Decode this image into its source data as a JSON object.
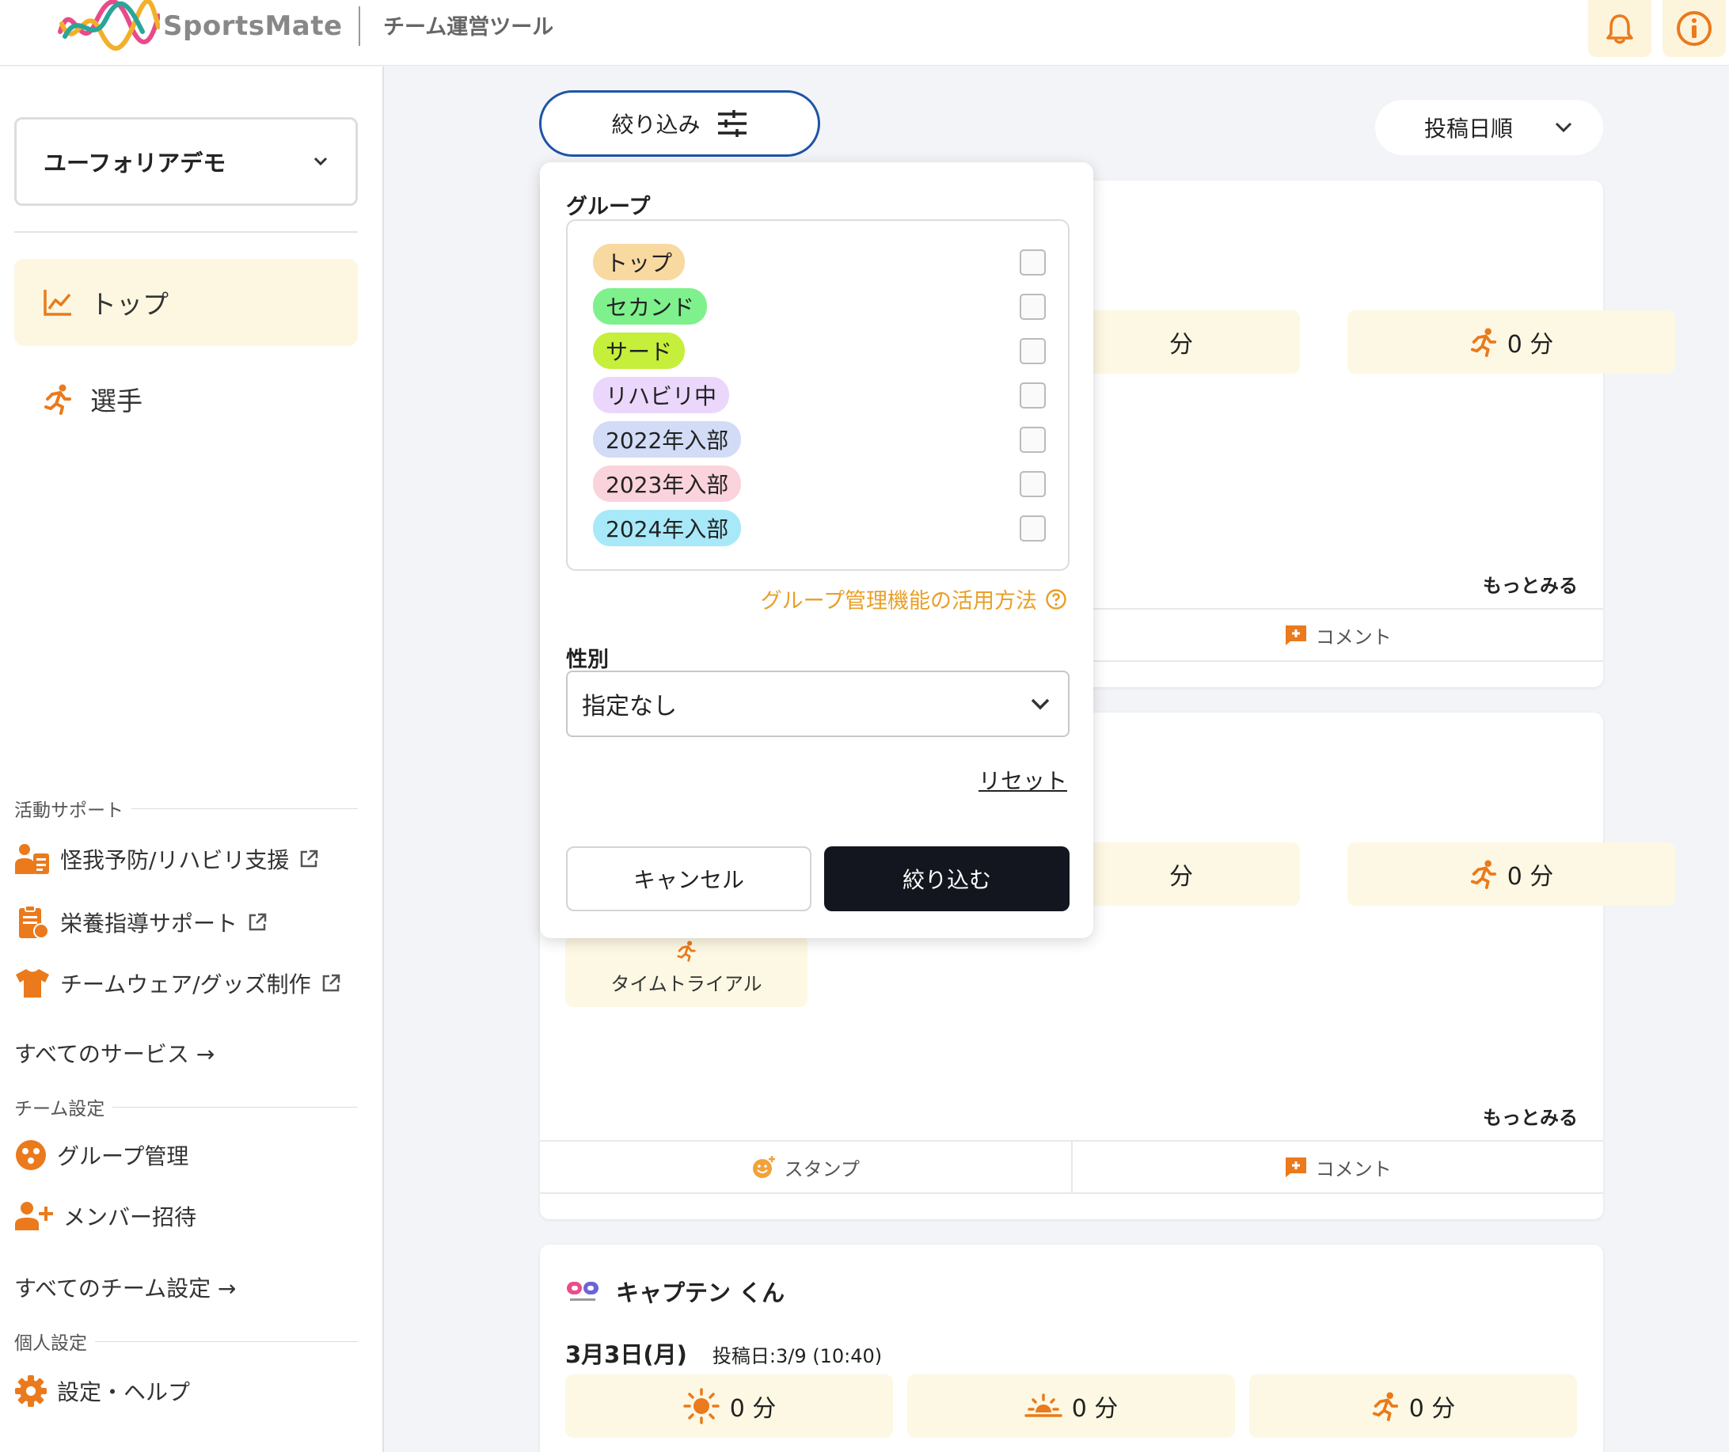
{
  "header": {
    "logo_text": "SportsMate",
    "subtitle": "チーム運営ツール",
    "bell_icon": "bell-icon",
    "info_icon": "info-icon"
  },
  "sidebar": {
    "team_select": "ユーフォリアデモ",
    "nav": [
      {
        "label": "トップ",
        "icon": "chart-line-icon",
        "active": true
      },
      {
        "label": "選手",
        "icon": "runner-icon",
        "active": false
      }
    ],
    "activity_support": {
      "title": "活動サポート",
      "items": [
        {
          "label": "怪我予防/リハビリ支援",
          "icon": "medical-support-icon"
        },
        {
          "label": "栄養指導サポート",
          "icon": "nutrition-clipboard-icon"
        },
        {
          "label": "チームウェア/グッズ制作",
          "icon": "tshirt-icon"
        }
      ],
      "all_link": "すべてのサービス →"
    },
    "team_settings": {
      "title": "チーム設定",
      "items": [
        {
          "label": "グループ管理",
          "icon": "group-icon"
        },
        {
          "label": "メンバー招待",
          "icon": "add-user-icon"
        }
      ],
      "all_link": "すべてのチーム設定 →"
    },
    "personal_settings": {
      "title": "個人設定",
      "items": [
        {
          "label": "設定・ヘルプ",
          "icon": "gear-icon"
        }
      ]
    }
  },
  "main": {
    "filter_button": "絞り込み",
    "sort_select": "投稿日順",
    "cards": [
      {
        "stat_partial": "分",
        "stat_run": "0 分",
        "more": "もっとみる",
        "comment": "コメント"
      },
      {
        "stat_partial": "分",
        "stat_run": "0 分",
        "activity_label": "タイムトライアル",
        "more": "もっとみる",
        "stamp": "スタンプ",
        "comment": "コメント"
      },
      {
        "author": "キャプテン くん",
        "date": "3月3日(月)",
        "posted": "投稿日:3/9 (10:40)",
        "stat_sun": "0 分",
        "stat_sunset": "0 分",
        "stat_run": "0 分"
      }
    ]
  },
  "filter_popover": {
    "group_label": "グループ",
    "groups": [
      {
        "label": "トップ",
        "color": "#f8d9a0"
      },
      {
        "label": "セカンド",
        "color": "#7ef08c"
      },
      {
        "label": "サード",
        "color": "#c5ef3a"
      },
      {
        "label": "リハビリ中",
        "color": "#ead7fb"
      },
      {
        "label": "2022年入部",
        "color": "#d2dcf7"
      },
      {
        "label": "2023年入部",
        "color": "#fbd3dc"
      },
      {
        "label": "2024年入部",
        "color": "#a7e9f8"
      }
    ],
    "help_link": "グループ管理機能の活用方法",
    "gender_label": "性別",
    "gender_value": "指定なし",
    "reset": "リセット",
    "cancel": "キャンセル",
    "apply": "絞り込む"
  },
  "colors": {
    "accent_orange": "#ea7a1c",
    "link_orange": "#e8a02a",
    "primary_blue": "#1e54a8",
    "dark_button": "#13161f",
    "highlight_bg": "#fdf7e1"
  }
}
